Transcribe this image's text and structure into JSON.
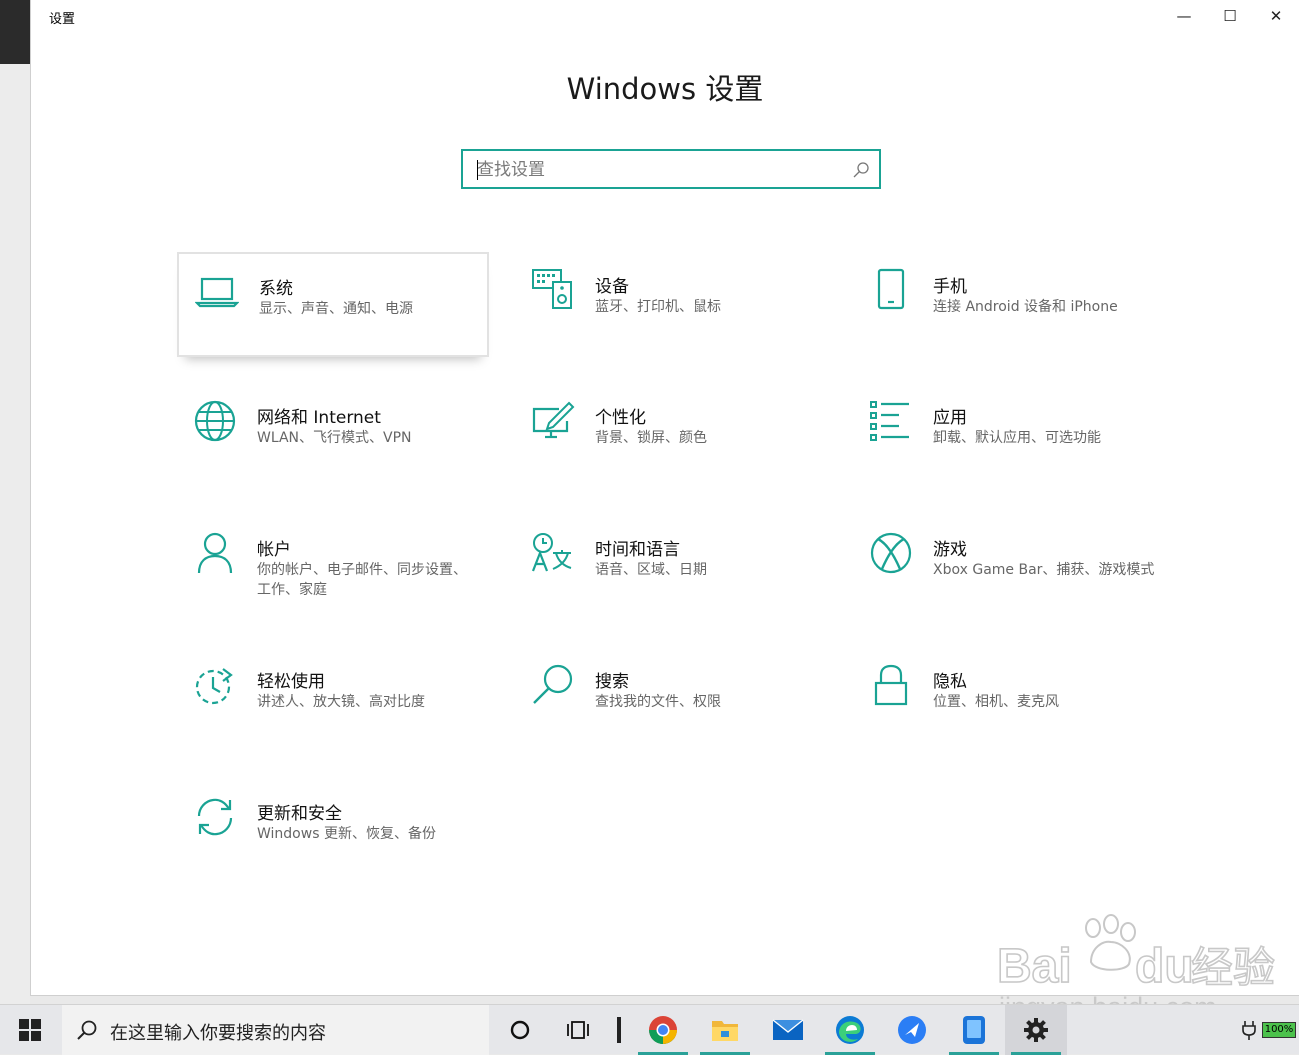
{
  "window": {
    "app_title": "设置",
    "page_title": "Windows 设置",
    "controls": {
      "minimize": "—",
      "maximize": "☐",
      "close": "✕"
    }
  },
  "search": {
    "placeholder": "查找设置",
    "value": "",
    "icon": "search-icon"
  },
  "accent_color": "#1aa394",
  "tiles": [
    {
      "title": "系统",
      "subtitle": "显示、声音、通知、电源",
      "icon": "laptop-icon",
      "selected": true
    },
    {
      "title": "设备",
      "subtitle": "蓝牙、打印机、鼠标",
      "icon": "devices-icon"
    },
    {
      "title": "手机",
      "subtitle": "连接 Android 设备和 iPhone",
      "icon": "phone-icon"
    },
    {
      "title": "网络和 Internet",
      "subtitle": "WLAN、飞行模式、VPN",
      "icon": "globe-icon"
    },
    {
      "title": "个性化",
      "subtitle": "背景、锁屏、颜色",
      "icon": "paint-icon"
    },
    {
      "title": "应用",
      "subtitle": "卸载、默认应用、可选功能",
      "icon": "apps-list-icon"
    },
    {
      "title": "帐户",
      "subtitle": "你的帐户、电子邮件、同步设置、工作、家庭",
      "icon": "person-icon"
    },
    {
      "title": "时间和语言",
      "subtitle": "语音、区域、日期",
      "icon": "time-language-icon"
    },
    {
      "title": "游戏",
      "subtitle": "Xbox Game Bar、捕获、游戏模式",
      "icon": "xbox-icon"
    },
    {
      "title": "轻松使用",
      "subtitle": "讲述人、放大镜、高对比度",
      "icon": "ease-of-access-icon"
    },
    {
      "title": "搜索",
      "subtitle": "查找我的文件、权限",
      "icon": "search-icon"
    },
    {
      "title": "隐私",
      "subtitle": "位置、相机、麦克风",
      "icon": "lock-icon"
    },
    {
      "title": "更新和安全",
      "subtitle": "Windows 更新、恢复、备份",
      "icon": "sync-icon"
    }
  ],
  "taskbar": {
    "search_text": "在这里输入你要搜索的内容",
    "apps": [
      "cortana-icon",
      "task-view-icon",
      "chrome-icon",
      "file-explorer-icon",
      "mail-icon",
      "edge-icon",
      "feishu-icon",
      "phone-link-icon",
      "settings-gear-icon"
    ],
    "battery": "100%"
  },
  "watermark": {
    "line1": "Bai",
    "line2": "du",
    "line3": "经验",
    "url": "jingyan.baidu.com"
  }
}
